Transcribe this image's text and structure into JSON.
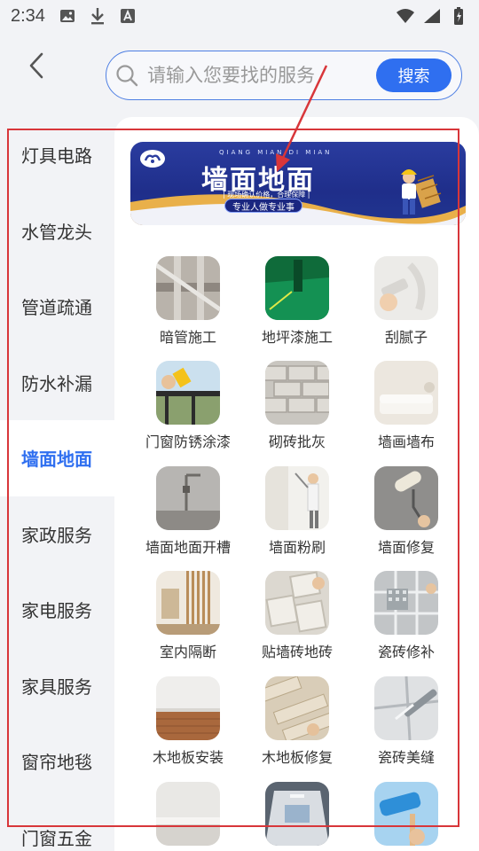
{
  "status_bar": {
    "time": "2:34",
    "icons_left": [
      "image-icon",
      "download-icon",
      "font-a-icon"
    ],
    "icons_right": [
      "wifi-icon",
      "signal-icon",
      "battery-charging-icon"
    ]
  },
  "header": {
    "back_icon": "chevron-left-icon",
    "search": {
      "placeholder": "请输入您要找的服务",
      "button_label": "搜索"
    }
  },
  "sidebar": {
    "active_index": 4,
    "items": [
      {
        "label": "灯具电路"
      },
      {
        "label": "水管龙头"
      },
      {
        "label": "管道疏通"
      },
      {
        "label": "防水补漏"
      },
      {
        "label": "墙面地面"
      },
      {
        "label": "家政服务"
      },
      {
        "label": "家电服务"
      },
      {
        "label": "家具服务"
      },
      {
        "label": "窗帘地毯"
      },
      {
        "label": "门窗五金"
      }
    ]
  },
  "banner": {
    "pinyin": "QIANG MIAN DI MIAN",
    "title": "墙面地面",
    "subtitle": "| 现场确认价格，合理保障 |",
    "tagline": "专业人做专业事"
  },
  "services": [
    {
      "label": "暗管施工"
    },
    {
      "label": "地坪漆施工"
    },
    {
      "label": "刮腻子"
    },
    {
      "label": "门窗防锈涂漆"
    },
    {
      "label": "砌砖批灰"
    },
    {
      "label": "墙画墙布"
    },
    {
      "label": "墙面地面开槽"
    },
    {
      "label": "墙面粉刷"
    },
    {
      "label": "墙面修复"
    },
    {
      "label": "室内隔断"
    },
    {
      "label": "贴墙砖地砖"
    },
    {
      "label": "瓷砖修补"
    },
    {
      "label": "木地板安装"
    },
    {
      "label": "木地板修复"
    },
    {
      "label": "瓷砖美缝"
    },
    {
      "label": ""
    },
    {
      "label": ""
    },
    {
      "label": ""
    }
  ],
  "colors": {
    "accent": "#2f6ff0",
    "annotation": "#d8363a",
    "banner": "#1f2e8a",
    "background": "#f2f3f6"
  }
}
